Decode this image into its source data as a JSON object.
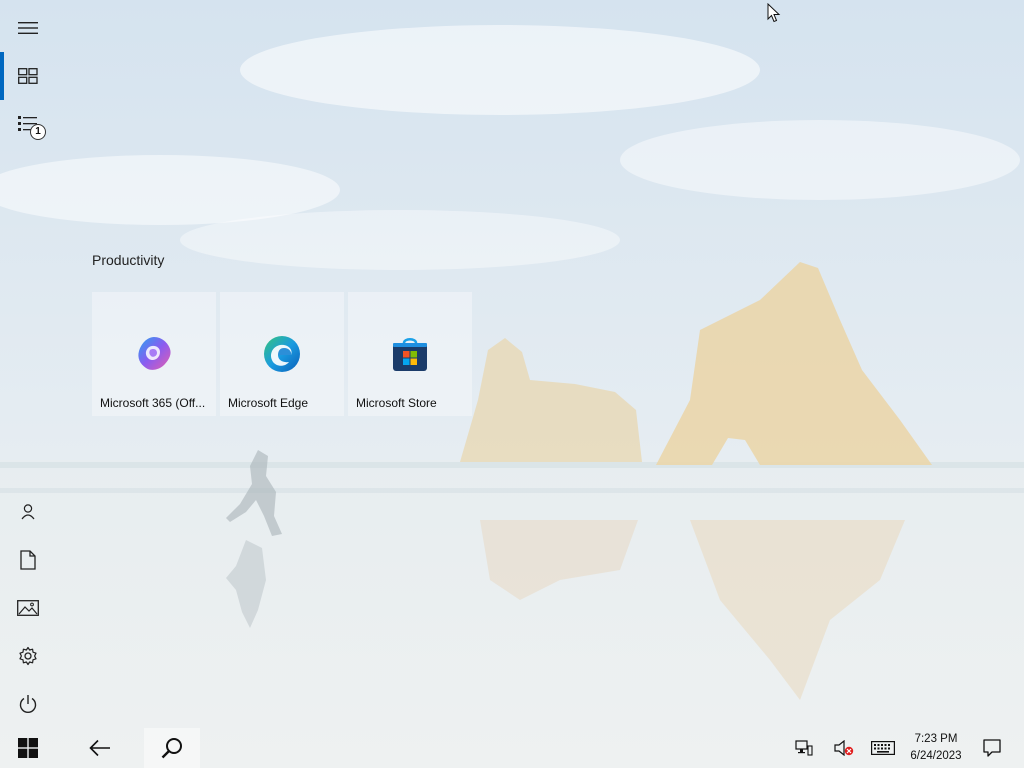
{
  "start_group": {
    "title": "Productivity",
    "tiles": [
      {
        "label": "Microsoft 365 (Off...",
        "icon": "microsoft-365-icon"
      },
      {
        "label": "Microsoft Edge",
        "icon": "edge-icon"
      },
      {
        "label": "Microsoft Store",
        "icon": "store-icon"
      }
    ]
  },
  "rail": {
    "items": [
      {
        "icon": "hamburger-menu-icon"
      },
      {
        "icon": "pinned-tiles-icon",
        "selected": true
      },
      {
        "icon": "all-apps-list-icon",
        "badge": "1"
      },
      {
        "icon": "user-icon"
      },
      {
        "icon": "documents-icon"
      },
      {
        "icon": "pictures-icon"
      },
      {
        "icon": "settings-gear-icon"
      },
      {
        "icon": "power-icon"
      }
    ]
  },
  "taskbar": {
    "items": [
      "windows-start-icon",
      "back-arrow-icon",
      "search-icon"
    ],
    "tray": [
      "network-icon",
      "volume-muted-icon",
      "keyboard-icon",
      "notifications-icon"
    ],
    "time": "7:23 PM",
    "date": "6/24/2023"
  },
  "colors": {
    "accent": "#0067c0",
    "sky": "#dfe8f0",
    "rock": "#e8d3a8"
  }
}
